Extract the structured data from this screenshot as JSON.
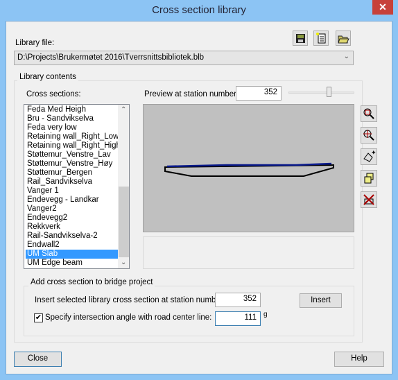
{
  "window": {
    "title": "Cross section library",
    "close_glyph": "✕"
  },
  "library_file": {
    "label": "Library file:",
    "path": "D:\\Projects\\Brukermøtet 2016\\Tverrsnittsbibliotek.blb"
  },
  "toolbar": {
    "icons": [
      "save-icon",
      "new-file-icon",
      "open-folder-icon"
    ]
  },
  "library_contents": {
    "label": "Library contents",
    "cross_sections_label": "Cross sections:",
    "items": [
      "Feda Med Heigh",
      "Bru - Sandvikselva",
      "Feda very low",
      "Retaining wall_Right_Low",
      "Retaining wall_Right_High",
      "Støttemur_Venstre_Lav",
      "Støttemur_Venstre_Høy",
      "Støttemur_Bergen",
      "Rail_Sandvikselva",
      "Vanger 1",
      "Endevegg - Landkar",
      "Vanger2",
      "Endevegg2",
      "Rekkverk",
      "Rail-Sandvikselva-2",
      "Endwall2",
      "UM Slab",
      "UM Edge beam"
    ],
    "selected": "UM Slab",
    "preview_label": "Preview at station number:",
    "preview_station": "352",
    "side_tools": [
      "zoom-extents-icon",
      "zoom-window-icon",
      "pan-icon",
      "copy-icon",
      "delete-icon"
    ]
  },
  "add_section": {
    "label": "Add cross section to bridge project",
    "insert_label": "Insert selected library cross section at station number:",
    "insert_station": "352",
    "insert_button": "Insert",
    "angle_checked": true,
    "angle_label": "Specify intersection angle with road center line:",
    "angle_value": "111",
    "angle_unit": "g"
  },
  "footer": {
    "close": "Close",
    "help": "Help"
  }
}
